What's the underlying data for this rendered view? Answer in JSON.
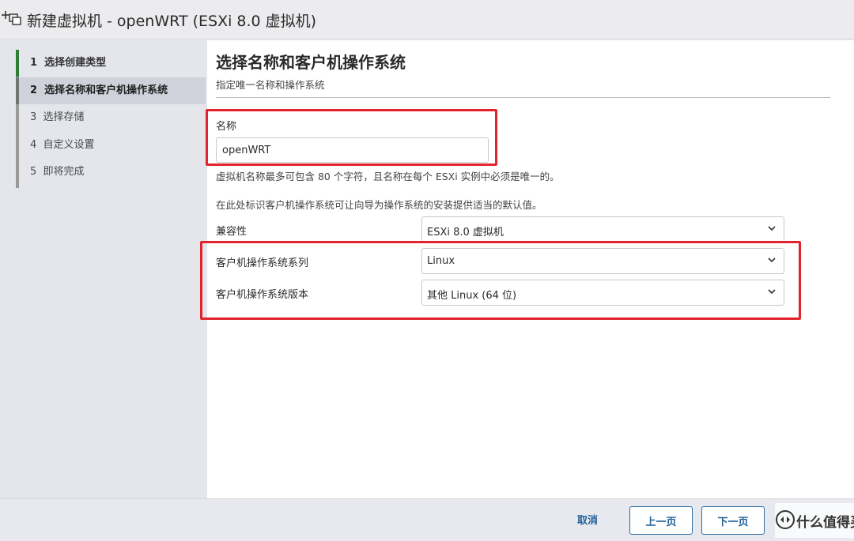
{
  "window": {
    "title": "新建虚拟机 - openWRT (ESXi 8.0 虚拟机)"
  },
  "steps": [
    {
      "num": "1",
      "label": "选择创建类型"
    },
    {
      "num": "2",
      "label": "选择名称和客户机操作系统"
    },
    {
      "num": "3",
      "label": "选择存储"
    },
    {
      "num": "4",
      "label": "自定义设置"
    },
    {
      "num": "5",
      "label": "即将完成"
    }
  ],
  "page": {
    "title": "选择名称和客户机操作系统",
    "subtitle": "指定唯一名称和操作系统"
  },
  "name_field": {
    "label": "名称",
    "value": "openWRT",
    "help": "虚拟机名称最多可包含 80 个字符，且名称在每个 ESXi 实例中必须是唯一的。"
  },
  "os_help": "在此处标识客户机操作系统可让向导为操作系统的安装提供适当的默认值。",
  "compatibility": {
    "label": "兼容性",
    "value": "ESXi 8.0 虚拟机"
  },
  "os_family": {
    "label": "客户机操作系统系列",
    "value": "Linux"
  },
  "os_version": {
    "label": "客户机操作系统版本",
    "value": "其他 Linux (64 位)"
  },
  "footer": {
    "cancel": "取消",
    "back": "上一页",
    "next": "下一页"
  },
  "watermark": {
    "text": "什么值得买"
  },
  "colors": {
    "highlight": "#e3232b",
    "accent": "#1f5f99",
    "step_done": "#2e7d32"
  }
}
